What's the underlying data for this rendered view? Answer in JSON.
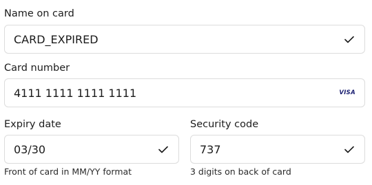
{
  "name_on_card": {
    "label": "Name on card",
    "value": "CARD_EXPIRED",
    "status_icon": "check-icon"
  },
  "card_number": {
    "label": "Card number",
    "value": "4111 1111 1111 1111",
    "brand_icon": "visa-icon",
    "brand_text": "VISA"
  },
  "expiry_date": {
    "label": "Expiry date",
    "value": "03/30",
    "status_icon": "check-icon",
    "hint": "Front of card in MM/YY format"
  },
  "security_code": {
    "label": "Security code",
    "value": "737",
    "status_icon": "check-icon",
    "hint": "3 digits on back of card"
  },
  "colors": {
    "border": "#dcdcdc",
    "check": "#1a1a1a",
    "visa": "#1a1f71"
  }
}
